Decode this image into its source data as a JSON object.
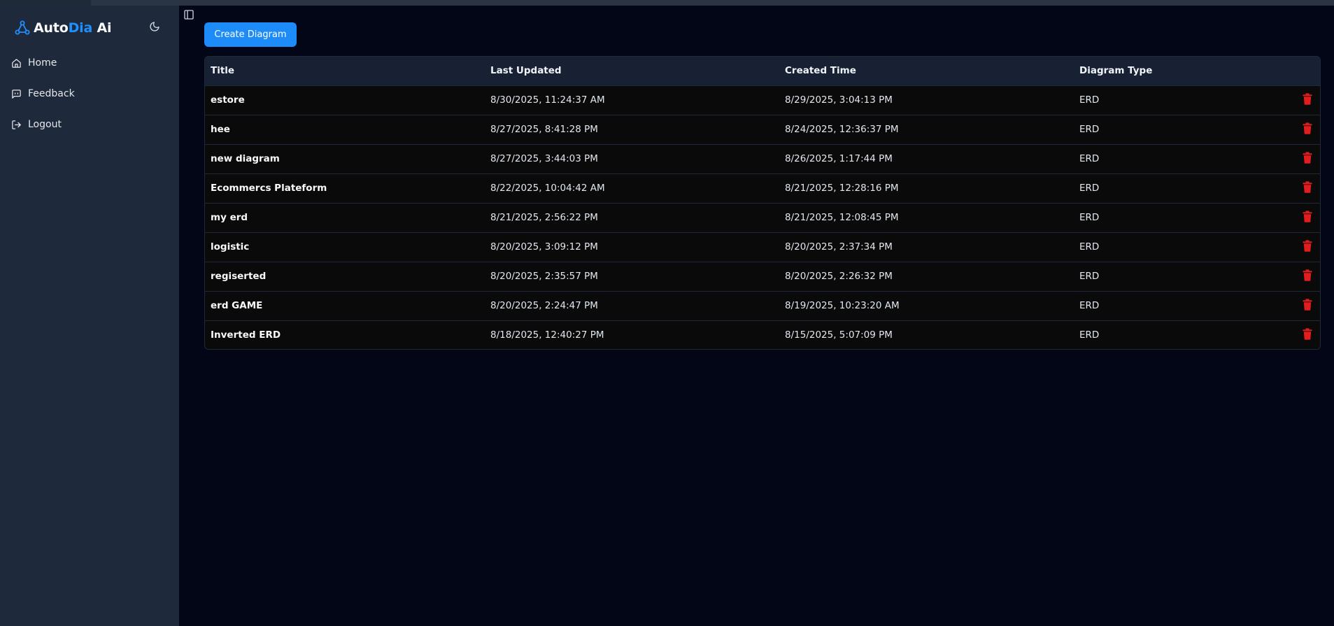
{
  "app": {
    "brand_part1": "Auto",
    "brand_part2": "Dia",
    "brand_part3": " Ai"
  },
  "sidebar": {
    "items": [
      {
        "label": "Home",
        "icon": "home-icon"
      },
      {
        "label": "Feedback",
        "icon": "message-square-icon"
      },
      {
        "label": "Logout",
        "icon": "logout-icon"
      }
    ]
  },
  "toolbar": {
    "create_label": "Create Diagram"
  },
  "table": {
    "headers": [
      "Title",
      "Last Updated",
      "Created Time",
      "Diagram Type"
    ],
    "rows": [
      {
        "title": "estore",
        "updated": "8/30/2025, 11:24:37 AM",
        "created": "8/29/2025, 3:04:13 PM",
        "type": "ERD"
      },
      {
        "title": "hee",
        "updated": "8/27/2025, 8:41:28 PM",
        "created": "8/24/2025, 12:36:37 PM",
        "type": "ERD"
      },
      {
        "title": "new diagram",
        "updated": "8/27/2025, 3:44:03 PM",
        "created": "8/26/2025, 1:17:44 PM",
        "type": "ERD"
      },
      {
        "title": "Ecommercs Plateform",
        "updated": "8/22/2025, 10:04:42 AM",
        "created": "8/21/2025, 12:28:16 PM",
        "type": "ERD"
      },
      {
        "title": "my erd",
        "updated": "8/21/2025, 2:56:22 PM",
        "created": "8/21/2025, 12:08:45 PM",
        "type": "ERD"
      },
      {
        "title": "logistic",
        "updated": "8/20/2025, 3:09:12 PM",
        "created": "8/20/2025, 2:37:34 PM",
        "type": "ERD"
      },
      {
        "title": "regiserted",
        "updated": "8/20/2025, 2:35:57 PM",
        "created": "8/20/2025, 2:26:32 PM",
        "type": "ERD"
      },
      {
        "title": "erd GAME",
        "updated": "8/20/2025, 2:24:47 PM",
        "created": "8/19/2025, 10:23:20 AM",
        "type": "ERD"
      },
      {
        "title": "Inverted ERD",
        "updated": "8/18/2025, 12:40:27 PM",
        "created": "8/15/2025, 5:07:09 PM",
        "type": "ERD"
      }
    ]
  },
  "colors": {
    "accent": "#1d8cf8",
    "delete": "#e11d1d",
    "sidebar_bg": "#1e293b",
    "main_bg": "#020617"
  }
}
